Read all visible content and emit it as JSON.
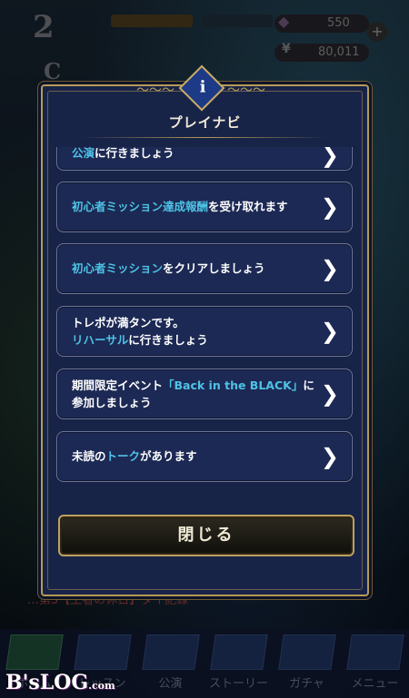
{
  "hud": {
    "level": "2",
    "rank": "C",
    "gems": "550",
    "money": "80,011",
    "money_symbol": "¥"
  },
  "modal": {
    "badge": "i",
    "title": "プレイナビ",
    "items": [
      {
        "parts": [
          {
            "text": "公演",
            "hl": true
          },
          {
            "text": "に行きましょう",
            "hl": false
          }
        ]
      },
      {
        "parts": [
          {
            "text": "初心者ミッション達成報酬",
            "hl": true
          },
          {
            "text": "を受け取れます",
            "hl": false
          }
        ]
      },
      {
        "parts": [
          {
            "text": "初心者ミッション",
            "hl": true
          },
          {
            "text": "をクリアしましょう",
            "hl": false
          }
        ]
      },
      {
        "parts": [
          {
            "text": "トレポが満タンです。",
            "hl": false
          },
          {
            "br": true
          },
          {
            "text": "リハーサル",
            "hl": true
          },
          {
            "text": "に行きましょう",
            "hl": false
          }
        ]
      },
      {
        "parts": [
          {
            "text": "期間限定イベント",
            "hl": false
          },
          {
            "text": "「Back in the BLACK」",
            "hl": true
          },
          {
            "text": "に参加しましょう",
            "hl": false
          }
        ]
      },
      {
        "parts": [
          {
            "text": "未読の",
            "hl": false
          },
          {
            "text": "トーク",
            "hl": true
          },
          {
            "text": "があります",
            "hl": false
          }
        ]
      }
    ],
    "close_label": "閉じる"
  },
  "ticker": "…第5【王者の休日】ダイ記録",
  "nav": [
    {
      "label": "ホーム",
      "icon": "home-icon"
    },
    {
      "label": "レッスン",
      "icon": "lesson-icon"
    },
    {
      "label": "公演",
      "icon": "live-icon"
    },
    {
      "label": "ストーリー",
      "icon": "story-icon"
    },
    {
      "label": "ガチャ",
      "icon": "gacha-icon"
    },
    {
      "label": "メニュー",
      "icon": "menu-icon"
    }
  ],
  "brand": "B'sLOG",
  "brand_suffix": ".com",
  "colors": {
    "highlight": "#4ec3e6",
    "gold": "#b79a58",
    "modal_bg": "#182447"
  }
}
